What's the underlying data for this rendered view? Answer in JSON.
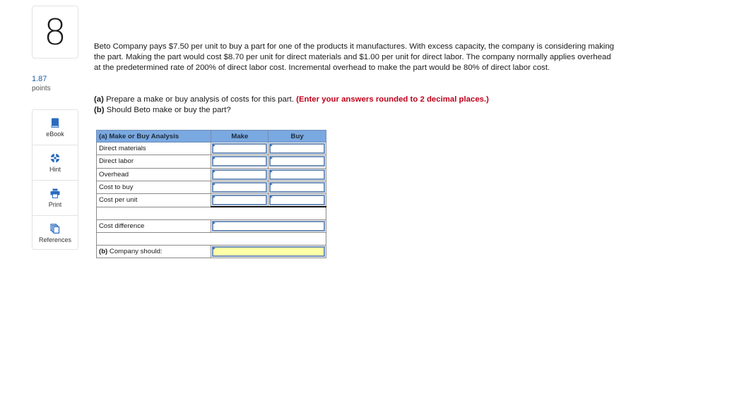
{
  "question": {
    "number": "8",
    "points_value": "1.87",
    "points_label": "points"
  },
  "tools": [
    {
      "label": "eBook",
      "icon": "book-icon"
    },
    {
      "label": "Hint",
      "icon": "lifebuoy-icon"
    },
    {
      "label": "Print",
      "icon": "printer-icon"
    },
    {
      "label": "References",
      "icon": "documents-icon"
    }
  ],
  "problem_text": "Beto Company pays $7.50 per unit to buy a part for one of the products it manufactures. With excess capacity, the company is considering making the part. Making the part would cost $8.70 per unit for direct materials and $1.00 per unit for direct labor. The company normally applies overhead at the predetermined rate of 200% of direct labor cost. Incremental overhead to make the part would be 80% of direct labor cost.",
  "instructions": {
    "a_tag": "(a)",
    "a_text": " Prepare a make or buy analysis of costs for this part. ",
    "a_note": "(Enter your answers rounded to 2 decimal places.)",
    "b_tag": "(b)",
    "b_text": " Should Beto make or buy the part?"
  },
  "table": {
    "header": {
      "label": "(a) Make or Buy Analysis",
      "make": "Make",
      "buy": "Buy"
    },
    "rows": [
      {
        "label": "Direct materials",
        "make": "",
        "buy": ""
      },
      {
        "label": "Direct labor",
        "make": "",
        "buy": ""
      },
      {
        "label": "Overhead",
        "make": "",
        "buy": ""
      },
      {
        "label": "Cost to buy",
        "make": "",
        "buy": ""
      },
      {
        "label": "Cost per unit",
        "make": "",
        "buy": ""
      }
    ],
    "cost_difference": {
      "label": "Cost difference",
      "value": ""
    },
    "company_should": {
      "tag": "(b)",
      "label": " Company should:",
      "value": ""
    }
  }
}
